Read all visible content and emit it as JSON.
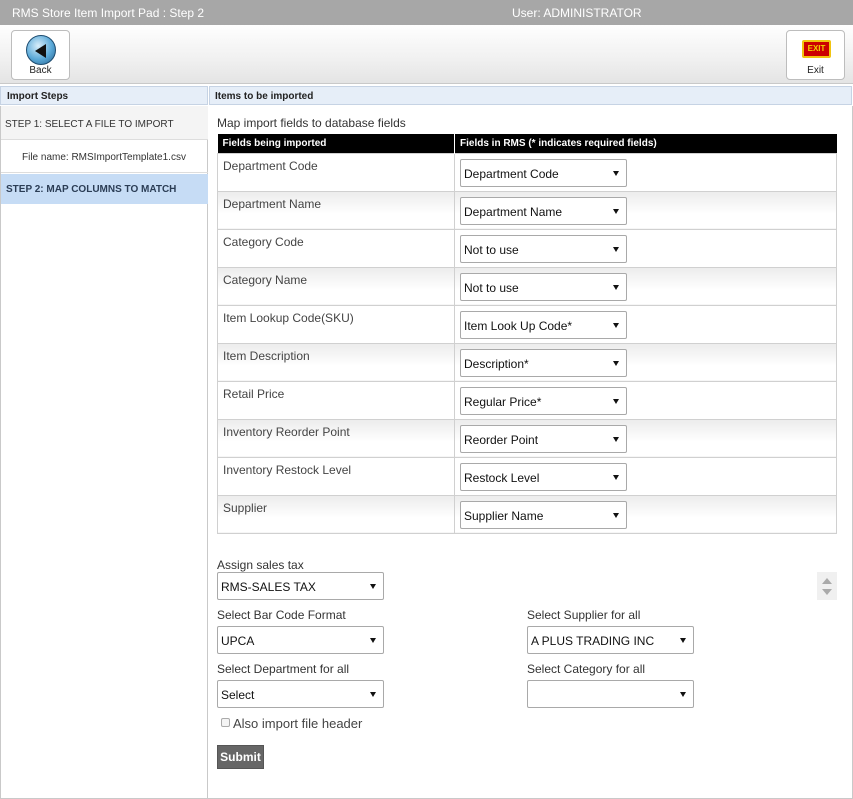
{
  "window": {
    "title": "RMS Store Item Import Pad : Step 2",
    "user": "User: ADMINISTRATOR"
  },
  "toolbar": {
    "back_label": "Back",
    "exit_label": "Exit",
    "exit_icon_text": "EXIT"
  },
  "left": {
    "header": "Import Steps",
    "step1": "STEP 1: SELECT A FILE TO IMPORT",
    "file_name": "File name: RMSImportTemplate1.csv",
    "step2": "STEP 2: MAP COLUMNS TO MATCH"
  },
  "main": {
    "header": "Items to be imported",
    "map_heading": "Map import fields to database fields",
    "col_imported": "Fields being imported",
    "col_rms": "Fields in RMS (* indicates required fields)",
    "rows": [
      {
        "field": "Department Code",
        "value": "Department Code"
      },
      {
        "field": "Department Name",
        "value": "Department Name"
      },
      {
        "field": "Category Code",
        "value": "Not to use"
      },
      {
        "field": "Category Name",
        "value": "Not to use"
      },
      {
        "field": "Item Lookup Code(SKU)",
        "value": "Item Look Up Code*"
      },
      {
        "field": "Item Description",
        "value": "Description*"
      },
      {
        "field": "Retail Price",
        "value": "Regular Price*"
      },
      {
        "field": "Inventory Reorder Point",
        "value": "Reorder Point"
      },
      {
        "field": "Inventory Restock Level",
        "value": "Restock Level"
      },
      {
        "field": "Supplier",
        "value": "Supplier Name"
      }
    ]
  },
  "form": {
    "tax_label": "Assign sales tax",
    "tax_value": "RMS-SALES TAX",
    "barcode_label": "Select Bar Code Format",
    "barcode_value": "UPCA",
    "supplier_label": "Select Supplier for all",
    "supplier_value": "A PLUS TRADING INC",
    "department_label": "Select Department for all",
    "department_value": "Select",
    "category_label": "Select Category for all",
    "category_value": "",
    "header_checkbox_label": "Also import file header",
    "submit_label": "Submit"
  }
}
